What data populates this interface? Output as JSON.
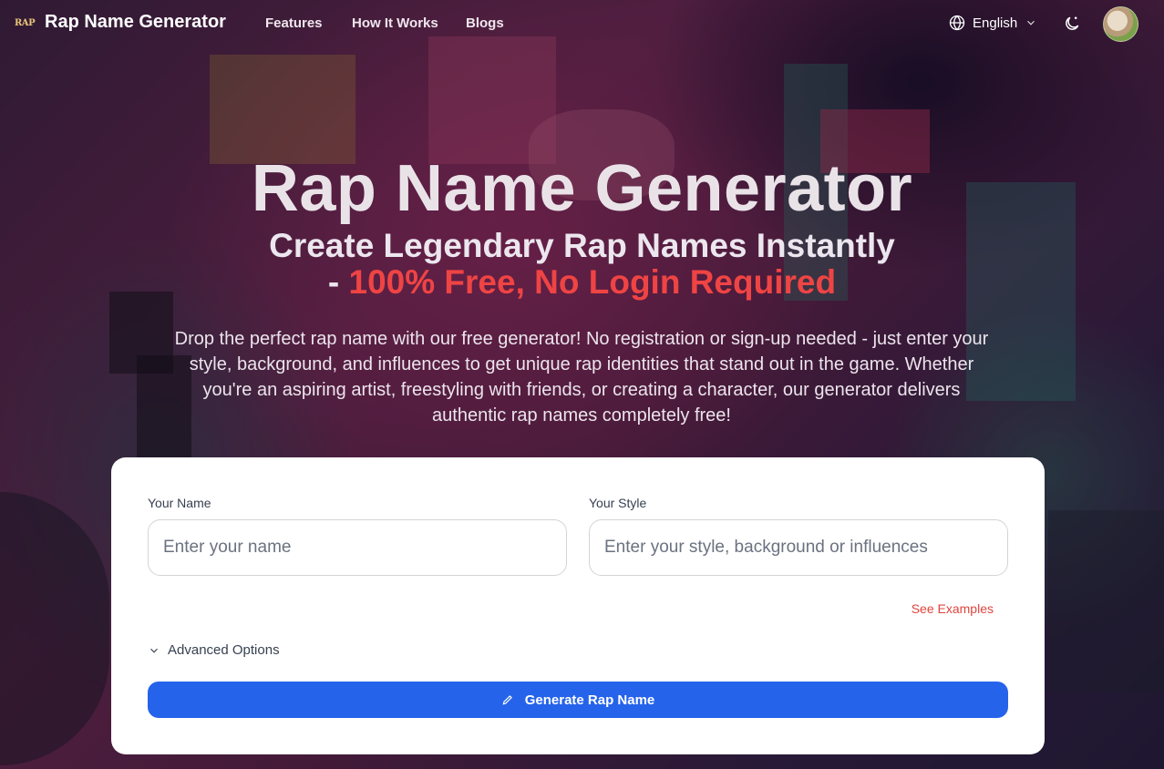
{
  "nav": {
    "logo_text": "RAP",
    "brand": "Rap Name Generator",
    "links": [
      "Features",
      "How It Works",
      "Blogs"
    ],
    "language": "English"
  },
  "hero": {
    "title": "Rap Name Generator",
    "subtitle_line1": "Create Legendary Rap Names Instantly",
    "subtitle_prefix": "- ",
    "subtitle_accent": "100% Free, No Login Required",
    "description": "Drop the perfect rap name with our free generator! No registration or sign-up needed - just enter your style, background, and influences to get unique rap identities that stand out in the game. Whether you're an aspiring artist, freestyling with friends, or creating a character, our generator delivers authentic rap names completely free!"
  },
  "form": {
    "name_label": "Your Name",
    "name_placeholder": "Enter your name",
    "style_label": "Your Style",
    "style_placeholder": "Enter your style, background or influences",
    "examples_link": "See Examples",
    "advanced_label": "Advanced Options",
    "generate_label": "Generate Rap Name"
  },
  "colors": {
    "accent": "#ef4444",
    "button": "#2563eb"
  },
  "icons": [
    "globe-icon",
    "chevron-down-icon",
    "moon-icon",
    "pencil-icon"
  ]
}
